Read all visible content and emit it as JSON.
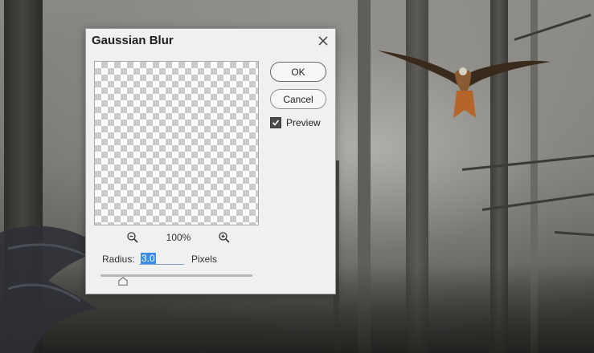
{
  "dialog": {
    "title": "Gaussian Blur",
    "ok_label": "OK",
    "cancel_label": "Cancel",
    "preview_label": "Preview",
    "preview_checked": true,
    "zoom_level": "100%",
    "radius_label": "Radius:",
    "radius_value": "3.0",
    "radius_unit": "Pixels",
    "slider_position": 0.15
  },
  "icons": [
    "close-icon",
    "zoom-out-icon",
    "zoom-in-icon",
    "checkmark-icon"
  ]
}
